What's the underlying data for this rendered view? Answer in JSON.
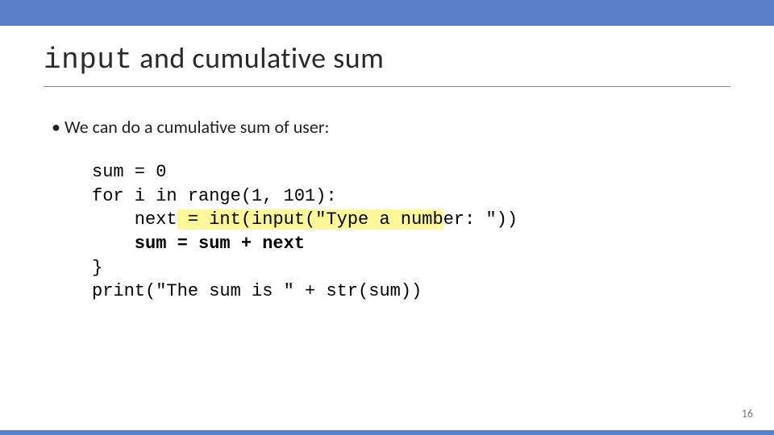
{
  "title": {
    "mono": "input",
    "rest": " and cumulative sum"
  },
  "bullet": "We can do a cumulative sum of user:",
  "code": {
    "l1": "sum = 0",
    "l2": "for i in range(1, 101):",
    "l3_a": "    next",
    "l3_b": " = int(input(\"Type a numb",
    "l3_c": "er: \"))",
    "l4": "    sum = sum + next",
    "l5": "}",
    "l6": "print(\"The sum is \" + str(sum))"
  },
  "pageNumber": "16"
}
